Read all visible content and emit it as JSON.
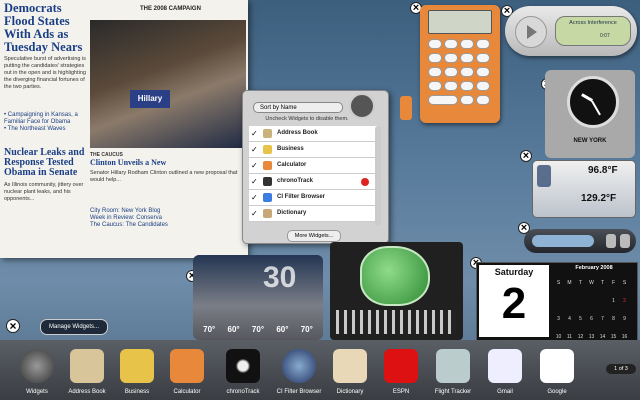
{
  "news": {
    "section": "THE 2008 CAMPAIGN",
    "headline1": "Democrats Flood States With Ads as Tuesday Nears",
    "headline2": "Nuclear Leaks and Response Tested Obama in Senate",
    "subhead": "Clinton Unveils a New",
    "caucus": "THE CAUCUS",
    "links": [
      "City Room: New York Blog",
      "Week in Review: Conserva",
      "The Caucus: The Candidates"
    ]
  },
  "widget_list": {
    "sort_label": "Sort by Name",
    "instruction": "Uncheck Widgets to disable them.",
    "items": [
      {
        "label": "Address Book",
        "color": "#c9b27c"
      },
      {
        "label": "Business",
        "color": "#e8c34a"
      },
      {
        "label": "Calculator",
        "color": "#e8883b"
      },
      {
        "label": "chronoTrack",
        "color": "#333333"
      },
      {
        "label": "CI Filter Browser",
        "color": "#3b7de0"
      },
      {
        "label": "Dictionary",
        "color": "#c8a878"
      }
    ],
    "more_label": "More Widgets..."
  },
  "itunes": {
    "line1": "Across Interference",
    "time": "0:07"
  },
  "clock": {
    "city": "NEW YORK"
  },
  "weather_small": {
    "temp1": "96.8°F",
    "temp2": "129.2°F"
  },
  "weather_big": {
    "temps": [
      "70°",
      "60°",
      "70°",
      "60°",
      "70°"
    ],
    "big_number": "30"
  },
  "calendar": {
    "weekday": "Saturday",
    "day": "2",
    "month": "February 2008",
    "headers": [
      "S",
      "M",
      "T",
      "W",
      "T",
      "F",
      "S"
    ]
  },
  "manage_button": "Manage Widgets...",
  "dock": {
    "items": [
      "Widgets",
      "Address Book",
      "Business",
      "Calculator",
      "chronoTrack",
      "CI Filter Browser",
      "Dictionary",
      "ESPN",
      "Flight Tracker",
      "Gmail",
      "Google"
    ],
    "page": "1 of 3"
  },
  "colors": {
    "accent": "#1a3f86",
    "dock_bg": "#3a3d42",
    "calc": "#e8883b"
  }
}
